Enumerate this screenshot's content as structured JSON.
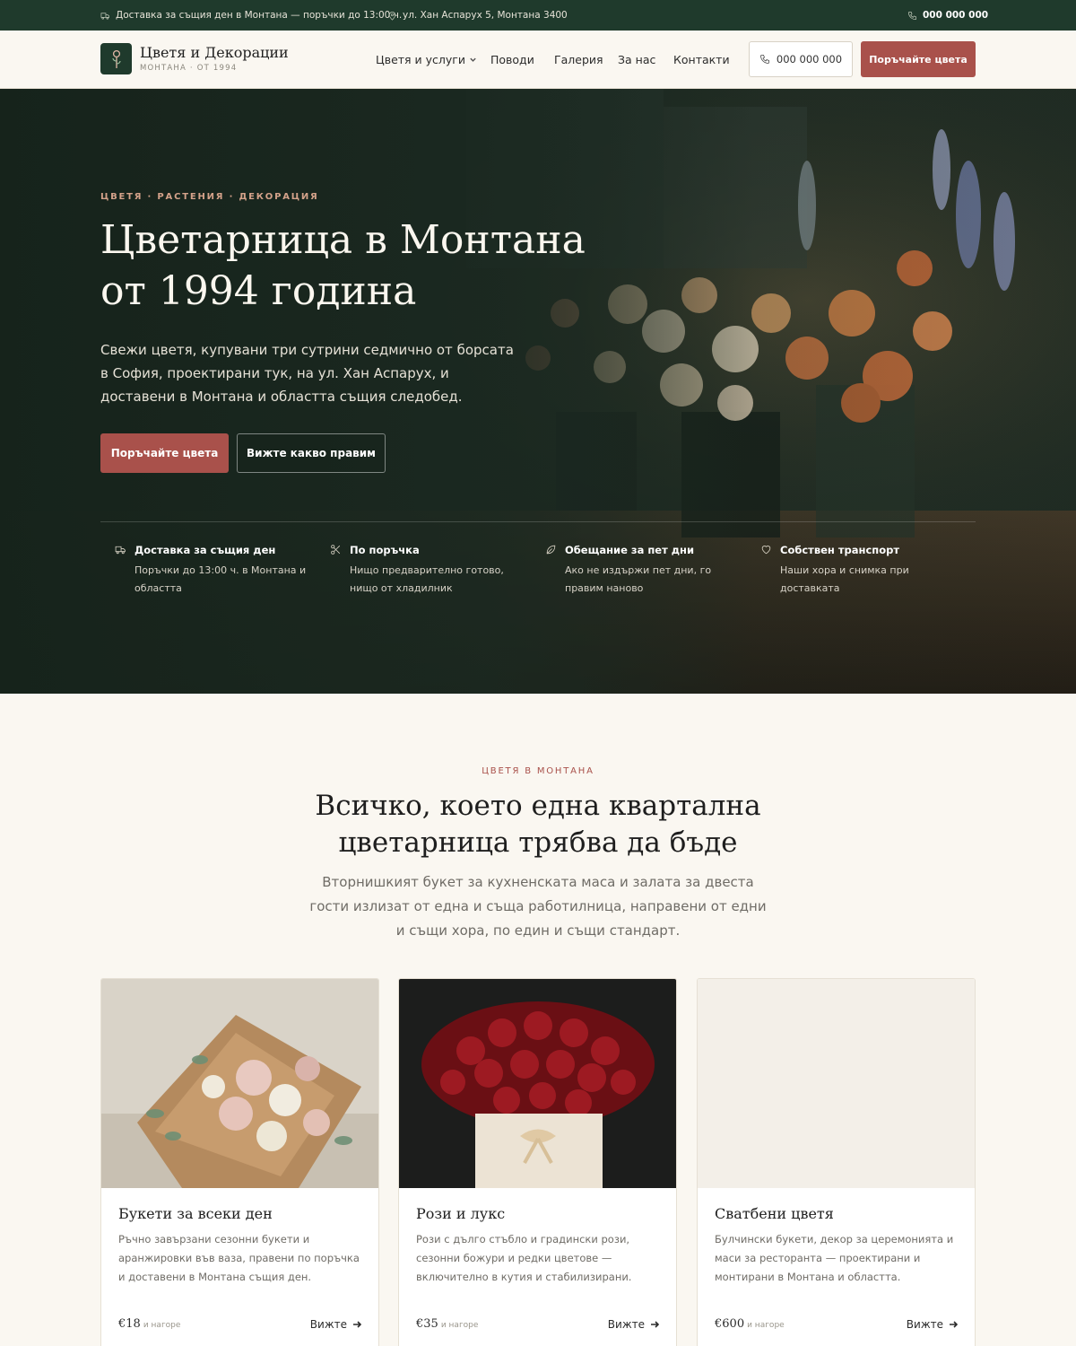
{
  "topbar": {
    "delivery_text": "Доставка за същия ден в Монтана — поръчки до 13:00 ч.",
    "address_text": "ул. Хан Аспарух 5, Монтана 3400",
    "phone": "000 000 000"
  },
  "header": {
    "brand_name": "Цветя и Декорации",
    "brand_sub": "МОНТАНА · ОТ 1994",
    "nav": [
      "Цветя и услуги",
      "Поводи",
      "Галерия",
      "За нас",
      "Контакти"
    ],
    "phone_button": "000 000 000",
    "order_button": "Поръчайте цвета"
  },
  "hero": {
    "eyebrow": "ЦВЕТЯ · РАСТЕНИЯ · ДЕКОРАЦИЯ",
    "title_line1": "Цветарница в Монтана",
    "title_line2": "от 1994 година",
    "description": "Свежи цветя, купувани три сутрини седмично от борсата в София, проектирани тук, на ул. Хан Аспарух, и доставени в Монтана и областта същия следобед.",
    "primary_button": "Поръчайте цвета",
    "secondary_button": "Вижте какво правим",
    "features": [
      {
        "icon": "truck-icon",
        "title": "Доставка за същия ден",
        "text": "Поръчки до 13:00 ч. в Монтана и областта"
      },
      {
        "icon": "scissors-icon",
        "title": "По поръчка",
        "text": "Нищо предварително готово, нищо от хладилник"
      },
      {
        "icon": "leaf-icon",
        "title": "Обещание за пет дни",
        "text": "Ако не издържи пет дни, го правим наново"
      },
      {
        "icon": "heart-icon",
        "title": "Собствен транспорт",
        "text": "Наши хора и снимка при доставката"
      }
    ]
  },
  "section": {
    "eyebrow": "ЦВЕТЯ В МОНТАНА",
    "title": "Всичко, което една квартална цветарница трябва да бъде",
    "description": "Вторнишкият букет за кухненската маса и залата за двеста гости излизат от една и съща работилница, направени от едни и същи хора, по един и същи стандарт."
  },
  "cards": [
    {
      "title": "Букети за всеки ден",
      "description": "Ръчно завързани сезонни букети и аранжировки във ваза, правени по поръчка и доставени в Монтана същия ден.",
      "price": "€18",
      "price_suffix": "и нагоре",
      "link": "Вижте"
    },
    {
      "title": "Рози и лукс",
      "description": "Рози с дълго стъбло и градински рози, сезонни божури и редки цветове — включително в кутия и стабилизирани.",
      "price": "€35",
      "price_suffix": "и нагоре",
      "link": "Вижте"
    },
    {
      "title": "Сватбени цветя",
      "description": "Булчински букети, декор за церемонията и маси за ресторанта — проектирани и монтирани в Монтана и областта.",
      "price": "€600",
      "price_suffix": "и нагоре",
      "link": "Вижте"
    }
  ],
  "colors": {
    "brand_green": "#1f3a2c",
    "accent_red": "#a9514b",
    "background": "#faf7f1"
  }
}
